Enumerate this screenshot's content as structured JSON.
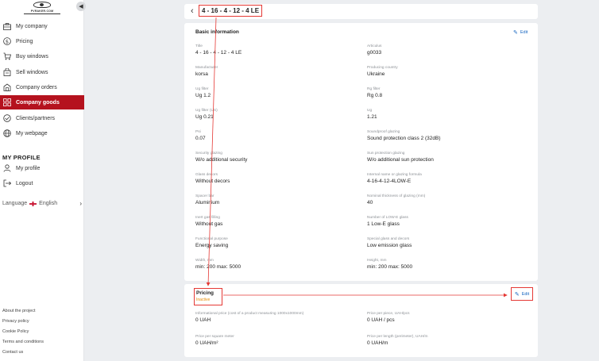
{
  "sidebar": {
    "logo_text": "PVRAKER.COM",
    "items": [
      {
        "label": "My company",
        "icon": "briefcase-icon"
      },
      {
        "label": "Pricing",
        "icon": "dollar-icon"
      },
      {
        "label": "Buy windows",
        "icon": "cart-icon"
      },
      {
        "label": "Sell windows",
        "icon": "bag-icon"
      },
      {
        "label": "Company orders",
        "icon": "orders-icon"
      },
      {
        "label": "Company goods",
        "icon": "goods-icon"
      },
      {
        "label": "Clients/partners",
        "icon": "handshake-icon"
      },
      {
        "label": "My webpage",
        "icon": "globe-icon"
      }
    ],
    "profile_title": "MY PROFILE",
    "profile_items": [
      {
        "label": "My profile",
        "icon": "user-icon"
      },
      {
        "label": "Logout",
        "icon": "logout-icon"
      }
    ],
    "language_label": "Language",
    "language_value": "English",
    "footer_links": [
      "About the project",
      "Privacy policy",
      "Cookie Policy",
      "Terms and conditions",
      "Contact us"
    ]
  },
  "header": {
    "title": "4 - 16 - 4 - 12 - 4 LE"
  },
  "basic": {
    "title": "Basic information",
    "edit_label": "Edit",
    "fields": [
      {
        "label": "Title",
        "value": "4 - 16 - 4 - 12 - 4 LE"
      },
      {
        "label": "Articulus",
        "value": "g0033"
      },
      {
        "label": "Manufacturer",
        "value": "korsa"
      },
      {
        "label": "Producing country",
        "value": "Ukraine"
      },
      {
        "label": "Ug filter",
        "value": "Ug 1.2"
      },
      {
        "label": "Rg filter",
        "value": "Rg 0.8"
      },
      {
        "label": "Ug filter (US)",
        "value": "Ug 0.21"
      },
      {
        "label": "Ug",
        "value": "1.21"
      },
      {
        "label": "Psi",
        "value": "0.07"
      },
      {
        "label": "Soundproof glazing",
        "value": "Sound protection class 2 (32dB)"
      },
      {
        "label": "Security glazing",
        "value": "W/o additional security"
      },
      {
        "label": "Sun protection glazing",
        "value": "W/o additional sun protection"
      },
      {
        "label": "Glass decors",
        "value": "Without decors"
      },
      {
        "label": "Internal name or glazing formula",
        "value": "4-16-4-12-4LOW-E"
      },
      {
        "label": "Spacer bar",
        "value": "Aluminium"
      },
      {
        "label": "Nominal thickness of glazing (mm)",
        "value": "40"
      },
      {
        "label": "Inert gas filling",
        "value": "Without gas"
      },
      {
        "label": "Number of LOW-E glass",
        "value": "1 Low-E glass"
      },
      {
        "label": "Functional purpose",
        "value": "Energy saving"
      },
      {
        "label": "Special glass and decors",
        "value": "Low emission glass"
      },
      {
        "label": "Width, mm",
        "value": "min: 200 max: 5000"
      },
      {
        "label": "Height, mm",
        "value": "min: 200 max: 5000"
      }
    ]
  },
  "pricing": {
    "title": "Pricing",
    "status": "Inactive",
    "edit_label": "Edit",
    "fields": [
      {
        "label": "Informational price (cost of a product measuring 1000x1000mm)",
        "value": "0 UAH"
      },
      {
        "label": "Price per piece, UAH/pcs",
        "value": "0 UAH / pcs"
      },
      {
        "label": "Price per square meter",
        "value": "0 UAH/m²"
      },
      {
        "label": "Price per length (perimeter), UAH/m",
        "value": "0 UAH/m"
      }
    ]
  },
  "colors": {
    "accent": "#b5121e",
    "annotation": "#e53935",
    "link": "#1565c0",
    "inactive": "#e68a00"
  }
}
